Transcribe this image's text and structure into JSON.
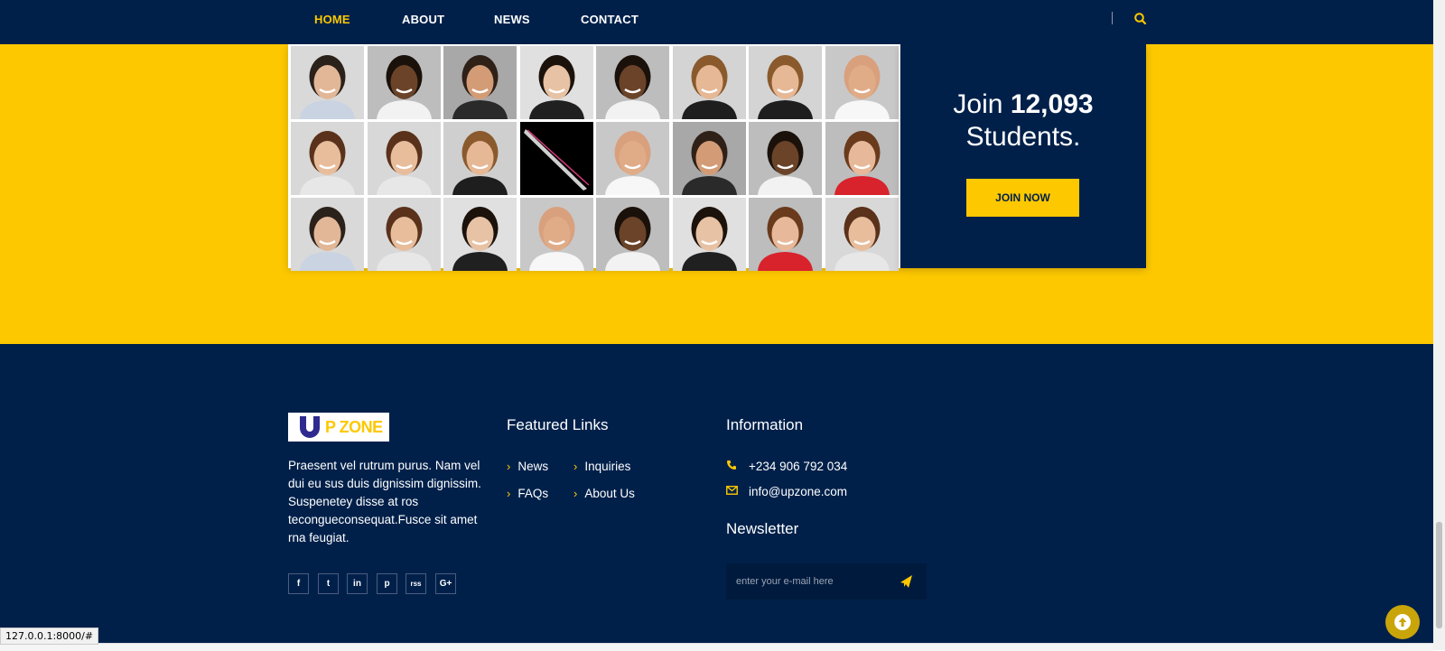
{
  "nav": {
    "items": [
      {
        "label": "HOME",
        "active": true
      },
      {
        "label": "ABOUT",
        "active": false
      },
      {
        "label": "NEWS",
        "active": false
      },
      {
        "label": "CONTACT",
        "active": false
      }
    ],
    "search_icon": "search-icon"
  },
  "join": {
    "prefix": "Join",
    "count": "12,093",
    "suffix": "Students.",
    "button_label": "JOIN NOW"
  },
  "photo_grid": {
    "rows": 3,
    "cols": 8
  },
  "footer": {
    "logo_text": "P ZONE",
    "about": "Praesent vel rutrum purus. Nam vel dui eu sus duis dignissim dignissim. Suspenetey disse at ros tecongueconsequat.Fusce sit amet rna feugiat.",
    "social": [
      {
        "icon": "facebook-icon",
        "glyph": "f"
      },
      {
        "icon": "twitter-icon",
        "glyph": "t"
      },
      {
        "icon": "linkedin-icon",
        "glyph": "in"
      },
      {
        "icon": "pinterest-icon",
        "glyph": "p"
      },
      {
        "icon": "rss-icon",
        "glyph": "rss"
      },
      {
        "icon": "google-plus-icon",
        "glyph": "G+"
      }
    ],
    "featured_title": "Featured Links",
    "links": [
      "News",
      "Inquiries",
      "FAQs",
      "About Us"
    ],
    "info_title": "Information",
    "phone": "+234 906 792 034",
    "email": "info@upzone.com",
    "newsletter_title": "Newsletter",
    "newsletter_placeholder": "enter your e-mail here"
  },
  "status_bar": {
    "url": "127.0.0.1:8000/#"
  },
  "colors": {
    "navy": "#00204a",
    "yellow": "#fdc800"
  }
}
